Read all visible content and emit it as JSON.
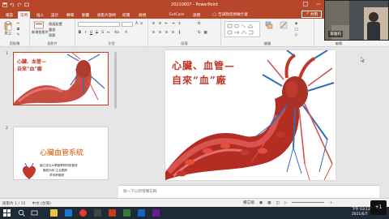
{
  "window": {
    "title": "20210607 - PowerPoint"
  },
  "tabs": [
    {
      "label": "檔案"
    },
    {
      "label": "常用"
    },
    {
      "label": "插入"
    },
    {
      "label": "設計"
    },
    {
      "label": "轉場"
    },
    {
      "label": "動畫"
    },
    {
      "label": "投影片放映"
    },
    {
      "label": "校閱"
    },
    {
      "label": "檢視"
    },
    {
      "label": "ExtCare"
    },
    {
      "label": "說明"
    }
  ],
  "search": {
    "label": "告訴我您想做什麼"
  },
  "share": {
    "label": "共用"
  },
  "ribbon": {
    "groups": {
      "clipboard": "剪貼簿",
      "slides": "投影片",
      "font": "字型",
      "paragraph": "段落",
      "drawing": "繪圖",
      "editing": "編輯"
    },
    "buttons": {
      "paste": "貼上",
      "new_slide": "新增投影片",
      "layout": "版面配置",
      "reset": "重設",
      "section": "章節"
    }
  },
  "webcam": {
    "name": "葉雅莉"
  },
  "slides": [
    {
      "number": "1",
      "title_line1": "心臟、血管—",
      "title_line2": "自來“血”廠"
    },
    {
      "number": "2",
      "title": "心臟血管系統",
      "author_line1": "國立成功大學醫學院附設醫院",
      "author_line2": "胸腔內科 主治醫師",
      "author_line3": "李采婷醫師"
    }
  ],
  "main_slide": {
    "title_line1": "心臟、血管—",
    "title_line2": "自來“血”廠"
  },
  "notes": {
    "placeholder": "按一下以新增備忘稿"
  },
  "statusbar": {
    "slide_count": "投影片 1 / 15",
    "language": "中文 (台灣)",
    "notes_label": "備忘稿",
    "zoom": "+"
  },
  "taskbar": {
    "time": "下午 03:12",
    "date": "2021/6/7"
  },
  "notification": {
    "text": "+1"
  },
  "colors": {
    "accent": "#b7472a",
    "title_red": "#c0392b"
  }
}
